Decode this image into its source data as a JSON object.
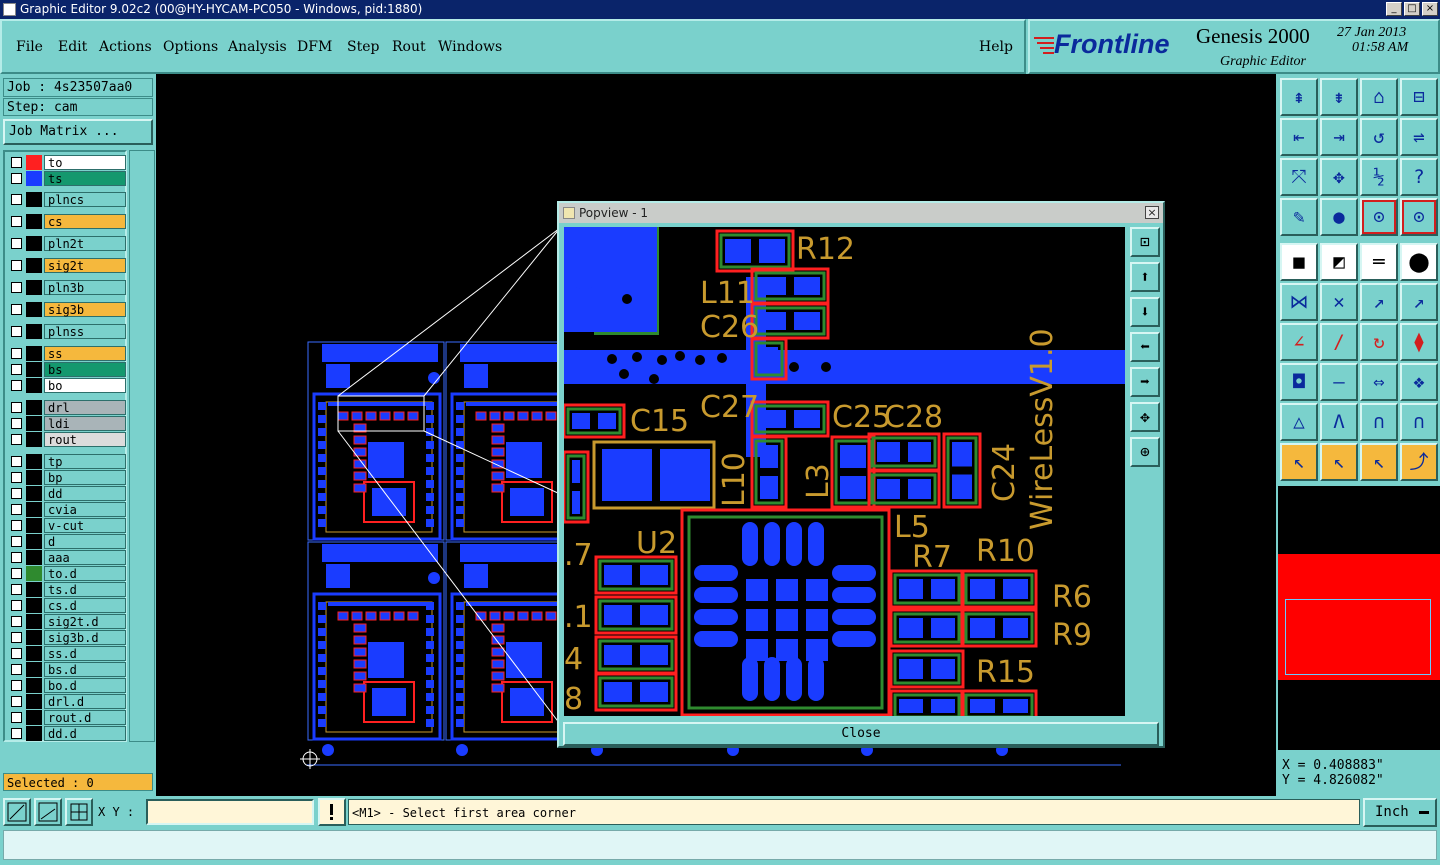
{
  "window": {
    "title": "Graphic Editor 9.02c2 (00@HY-HYCAM-PC050 - Windows, pid:1880)"
  },
  "menu": {
    "items": [
      "File",
      "Edit",
      "Actions",
      "Options",
      "Analysis",
      "DFM",
      "Step",
      "Rout",
      "Windows"
    ],
    "help": "Help"
  },
  "brand": {
    "company": "Frontline",
    "product": "Genesis 2000",
    "subtitle": "Graphic Editor",
    "date": "27 Jan 2013",
    "time": "01:58 AM"
  },
  "job": {
    "job_label": "Job : 4s23507aa0",
    "step_label": "Step: cam",
    "matrix_button": "Job Matrix ..."
  },
  "layers": [
    {
      "name": "to",
      "color": "#ff2020",
      "bg": "#ffffff"
    },
    {
      "name": "ts",
      "color": "#1a3cff",
      "bg": "#14986e"
    },
    {
      "name": "plncs",
      "color": "#000000",
      "bg": "#7ad1cc"
    },
    {
      "name": "cs",
      "color": "#000000",
      "bg": "#f5b83d"
    },
    {
      "name": "pln2t",
      "color": "#000000",
      "bg": "#7ad1cc"
    },
    {
      "name": "sig2t",
      "color": "#000000",
      "bg": "#f5b83d"
    },
    {
      "name": "pln3b",
      "color": "#000000",
      "bg": "#7ad1cc"
    },
    {
      "name": "sig3b",
      "color": "#000000",
      "bg": "#f5b83d"
    },
    {
      "name": "plnss",
      "color": "#000000",
      "bg": "#7ad1cc"
    },
    {
      "name": "ss",
      "color": "#000000",
      "bg": "#f5b83d"
    },
    {
      "name": "bs",
      "color": "#000000",
      "bg": "#14986e"
    },
    {
      "name": "bo",
      "color": "#000000",
      "bg": "#ffffff"
    },
    {
      "name": "drl",
      "color": "#000000",
      "bg": "#a9b4b8"
    },
    {
      "name": "ldi",
      "color": "#000000",
      "bg": "#a9b4b8"
    },
    {
      "name": "rout",
      "color": "#000000",
      "bg": "#dcdcdc"
    },
    {
      "name": "tp",
      "color": "#000000",
      "bg": "#7ad1cc"
    },
    {
      "name": "bp",
      "color": "#000000",
      "bg": "#7ad1cc"
    },
    {
      "name": "dd",
      "color": "#000000",
      "bg": "#7ad1cc"
    },
    {
      "name": "cvia",
      "color": "#000000",
      "bg": "#7ad1cc"
    },
    {
      "name": "v-cut",
      "color": "#000000",
      "bg": "#7ad1cc"
    },
    {
      "name": "d",
      "color": "#000000",
      "bg": "#7ad1cc"
    },
    {
      "name": "aaa",
      "color": "#000000",
      "bg": "#7ad1cc"
    },
    {
      "name": "to.d",
      "color": "#2f8a2f",
      "bg": "#7ad1cc"
    },
    {
      "name": "ts.d",
      "color": "#000000",
      "bg": "#7ad1cc"
    },
    {
      "name": "cs.d",
      "color": "#000000",
      "bg": "#7ad1cc"
    },
    {
      "name": "sig2t.d",
      "color": "#000000",
      "bg": "#7ad1cc"
    },
    {
      "name": "sig3b.d",
      "color": "#000000",
      "bg": "#7ad1cc"
    },
    {
      "name": "ss.d",
      "color": "#000000",
      "bg": "#7ad1cc"
    },
    {
      "name": "bs.d",
      "color": "#000000",
      "bg": "#7ad1cc"
    },
    {
      "name": "bo.d",
      "color": "#000000",
      "bg": "#7ad1cc"
    },
    {
      "name": "drl.d",
      "color": "#000000",
      "bg": "#7ad1cc"
    },
    {
      "name": "rout.d",
      "color": "#000000",
      "bg": "#7ad1cc"
    },
    {
      "name": "dd.d",
      "color": "#000000",
      "bg": "#7ad1cc"
    }
  ],
  "selected": "Selected : 0",
  "popview": {
    "title": "Popview - 1",
    "close_label": "Close",
    "labels": [
      "R12",
      "L11",
      "C26",
      "C27",
      "C15",
      "C25",
      "C28",
      "L10",
      "L3",
      "C24",
      "L5",
      "U2",
      "R7",
      "R10",
      "R6",
      "R9",
      "R15",
      "WireLessV1.0",
      ".7",
      ".1",
      "4",
      "8"
    ]
  },
  "coords": {
    "x": "X = 0.408883\"",
    "y": "Y = 4.826082\""
  },
  "statusbar": {
    "xy_label": "X Y :",
    "xy_value": "",
    "prompt": "<M1> - Select first area corner",
    "units": "Inch"
  },
  "colors": {
    "panel": "#7ad1cc",
    "canvas": "#000000",
    "pad": "#1a3cff",
    "outline": "#ff2020",
    "silk": "#c89a2e",
    "mask": "#2f8a2f",
    "title_bg": "#0a246a"
  }
}
